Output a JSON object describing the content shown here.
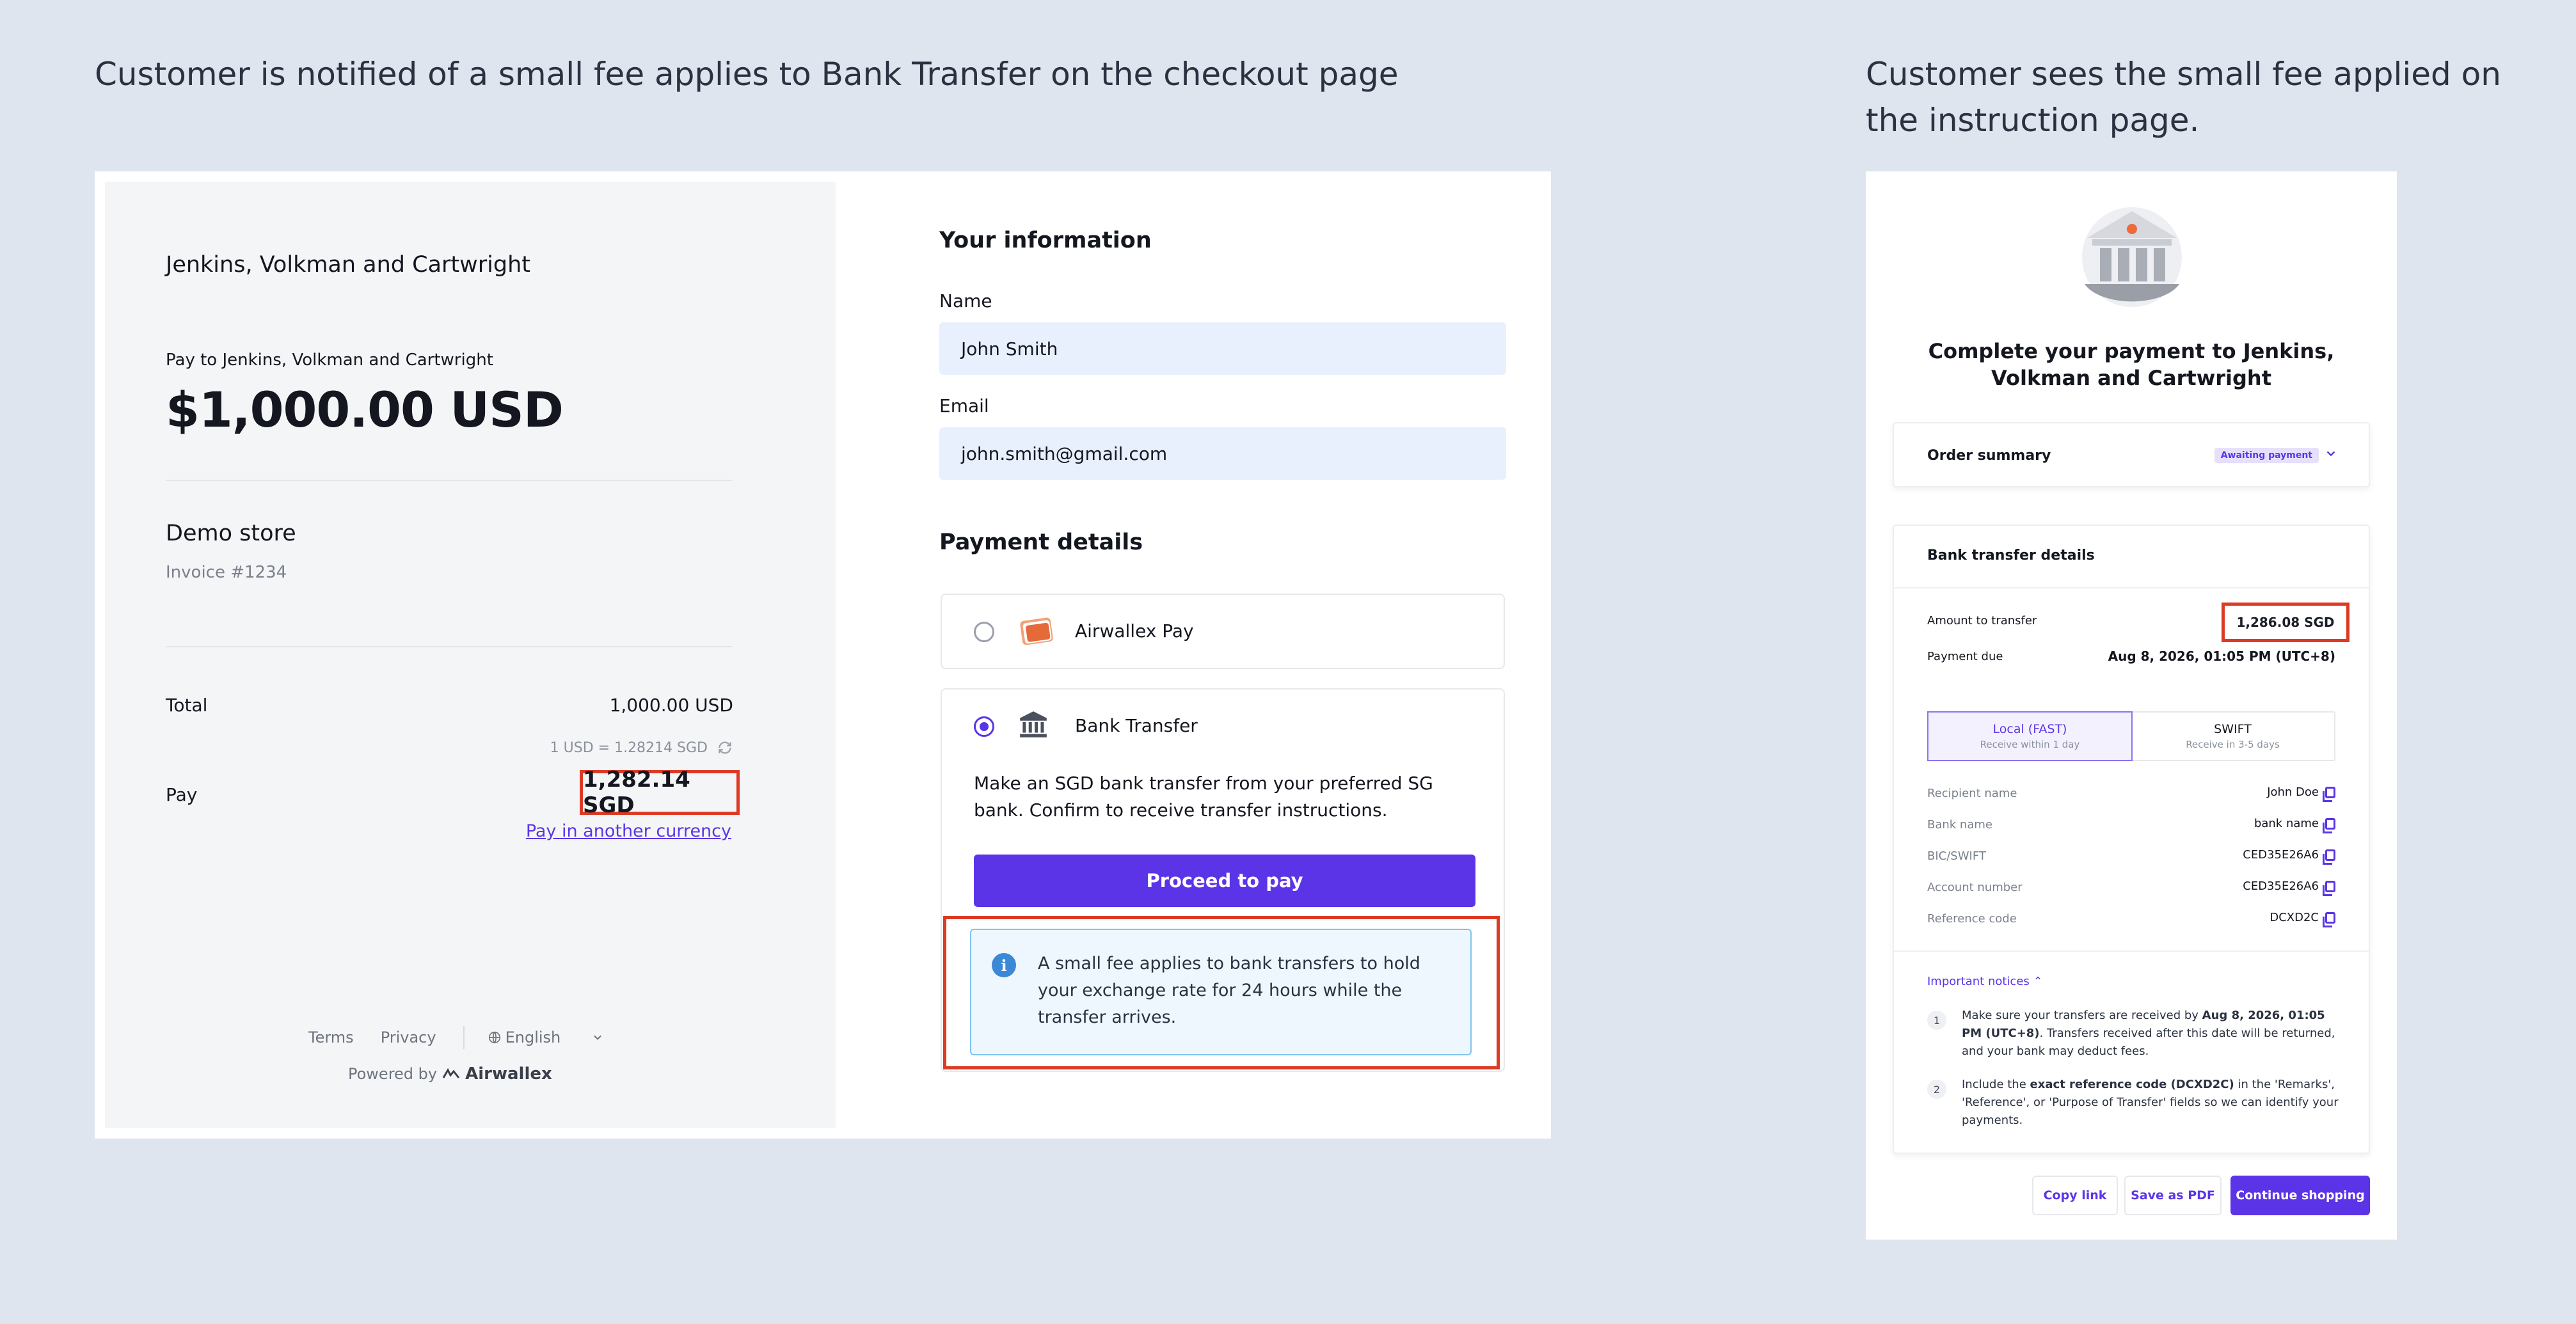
{
  "captions": {
    "left": "Customer is notified of a small fee applies to Bank Transfer on the checkout page",
    "right": "Customer sees the small fee applied on the instruction page."
  },
  "checkout": {
    "merchant_name": "Jenkins, Volkman and Cartwright",
    "pay_to": "Pay to Jenkins, Volkman and Cartwright",
    "amount": "$1,000.00 USD",
    "store_name": "Demo store",
    "invoice": "Invoice #1234",
    "total_label": "Total",
    "total_value": "1,000.00 USD",
    "rate": "1 USD = 1.28214 SGD",
    "pay_label": "Pay",
    "pay_value": "1,282.14 SGD",
    "pay_other_currency": "Pay in another currency",
    "footer": {
      "terms": "Terms",
      "privacy": "Privacy",
      "language": "English",
      "powered_by": "Powered by",
      "brand": "Airwallex"
    },
    "form": {
      "your_info_title": "Your information",
      "name_label": "Name",
      "name_value": "John Smith",
      "email_label": "Email",
      "email_value": "john.smith@gmail.com",
      "payment_details_title": "Payment details",
      "methods": [
        {
          "name": "Airwallex Pay",
          "selected": false
        },
        {
          "name": "Bank Transfer",
          "selected": true
        }
      ],
      "bank_transfer_desc": "Make an SGD bank transfer from your preferred SG bank. Confirm to receive transfer instructions.",
      "proceed_label": "Proceed to pay",
      "fee_notice": "A small fee applies to bank transfers to hold your exchange rate for 24 hours while the transfer arrives."
    }
  },
  "instruction": {
    "title": "Complete your payment to Jenkins, Volkman and Cartwright",
    "order_summary": "Order summary",
    "status_badge": "Awaiting payment",
    "details_title": "Bank transfer details",
    "amount_label": "Amount to transfer",
    "amount_value": "1,286.08 SGD",
    "due_label": "Payment due",
    "due_value": "Aug 8, 2026, 01:05 PM (UTC+8)",
    "tabs": [
      {
        "title": "Local (FAST)",
        "sub": "Receive within 1 day",
        "active": true
      },
      {
        "title": "SWIFT",
        "sub": "Receive in 3-5 days",
        "active": false
      }
    ],
    "details": [
      {
        "label": "Recipient name",
        "value": "John Doe"
      },
      {
        "label": "Bank name",
        "value": "bank name"
      },
      {
        "label": "BIC/SWIFT",
        "value": "CED35E26A6"
      },
      {
        "label": "Account number",
        "value": "CED35E26A6"
      },
      {
        "label": "Reference code",
        "value": "DCXD2C"
      }
    ],
    "notices_link": "Important notices",
    "notices": [
      {
        "num": "1",
        "pre": "Make sure your transfers are received by ",
        "bold": "Aug 8, 2026, 01:05 PM (UTC+8)",
        "post": ". Transfers received after this date will be returned, and your bank may deduct fees."
      },
      {
        "num": "2",
        "pre": "Include the ",
        "bold": "exact reference code (DCXD2C)",
        "post": " in the 'Remarks', 'Reference', or 'Purpose of Transfer' fields so we can identify your payments."
      }
    ],
    "buttons": {
      "copy_link": "Copy link",
      "save_pdf": "Save as PDF",
      "continue": "Continue shopping"
    }
  },
  "colors": {
    "accent": "#5b34e8",
    "highlight": "#dd3a26",
    "background": "#dfe5ee"
  }
}
